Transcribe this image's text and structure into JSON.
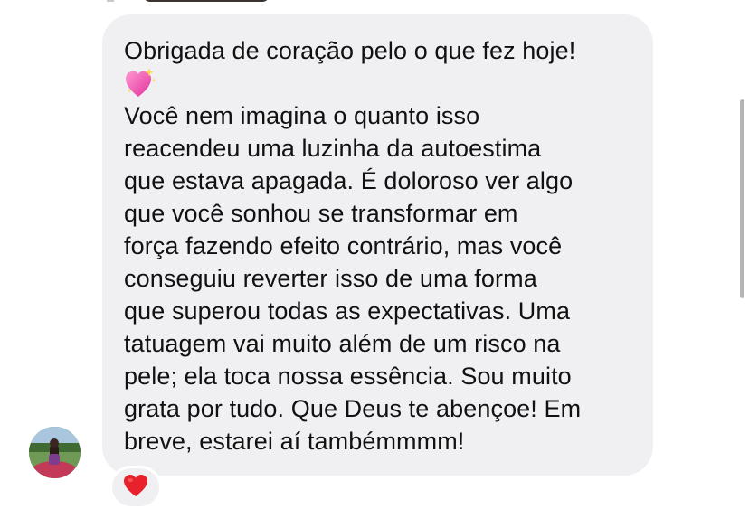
{
  "message": {
    "line1": "Obrigada de coração pelo o que fez hoje!",
    "emoji": "sparkling-heart",
    "body_lines": [
      "Você nem imagina o quanto isso",
      "reacendeu uma luzinha da autoestima",
      "que estava apagada. É doloroso ver algo",
      "que você sonhou se transformar em",
      "força fazendo efeito contrário, mas você",
      "conseguiu reverter isso de uma forma",
      "que superou todas as expectativas. Uma",
      "tatuagem vai muito além de um risco na",
      "pele; ela toca nossa essência. Sou muito",
      "grata por tudo. Que Deus te abençoe! Em",
      "breve, estarei aí tambémmmm!"
    ]
  },
  "reaction": {
    "emoji": "red-heart"
  },
  "colors": {
    "bubble_bg": "#f0f0f2",
    "text": "#111111",
    "heart_red": "#e8222c"
  }
}
